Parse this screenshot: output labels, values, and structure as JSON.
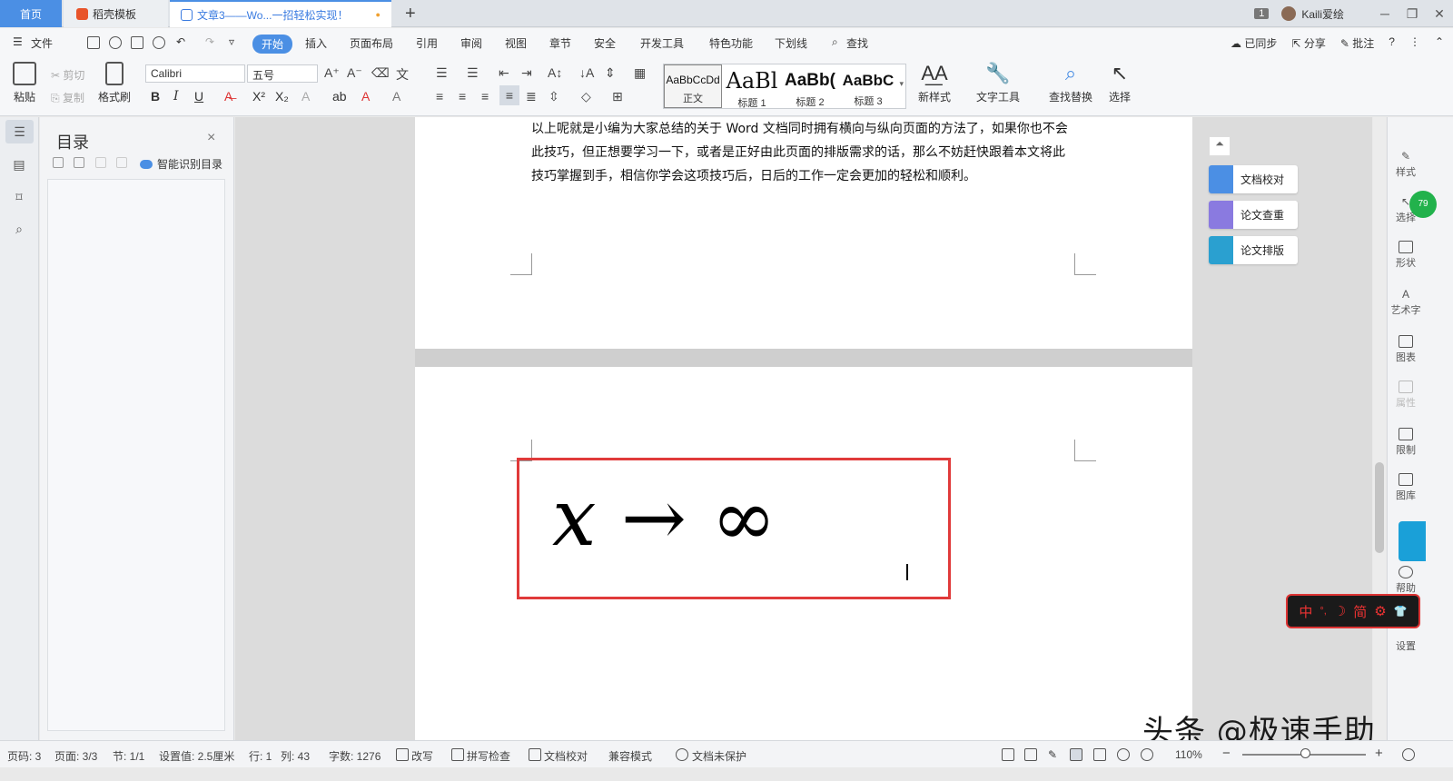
{
  "tabs": {
    "home": "首页",
    "template": "稻壳模板",
    "document": "文章3——Wo...一招轻松实现！",
    "unsaved_dot": "●",
    "new_tab": "+",
    "page_badge": "1",
    "user": "Kaili爱绘",
    "minimize": "─",
    "restore": "❐",
    "close": "✕"
  },
  "menu": {
    "file": "文件",
    "start": "开始",
    "insert": "插入",
    "layout": "页面布局",
    "reference": "引用",
    "review": "审阅",
    "view": "视图",
    "chapter": "章节",
    "security": "安全",
    "devtools": "开发工具",
    "special": "特色功能",
    "underline": "下划线",
    "find": "查找",
    "synced": "已同步",
    "share": "分享",
    "comment": "批注",
    "help": "?",
    "more": "⋮",
    "collapse": "⌃"
  },
  "ribbon": {
    "paste": "粘贴",
    "cut": "剪切",
    "copy": "复制",
    "format_painter": "格式刷",
    "font_name": "Calibri",
    "font_size": "五号",
    "bold": "B",
    "italic": "I",
    "underline": "U",
    "styles": [
      {
        "sample": "AaBbCcDd",
        "label": "正文"
      },
      {
        "sample": "AaBl",
        "label": "标题 1"
      },
      {
        "sample": "AaBb(",
        "label": "标题 2"
      },
      {
        "sample": "AaBbC",
        "label": "标题 3"
      }
    ],
    "new_style": "新样式",
    "text_tools": "文字工具",
    "find_replace": "查找替换",
    "select": "选择"
  },
  "toc": {
    "title": "目录",
    "close": "×",
    "smart": "智能识别目录"
  },
  "document": {
    "paragraph": "以上呢就是小编为大家总结的关于 Word 文档同时拥有横向与纵向页面的方法了，如果你也不会此技巧，但正想要学习一下，或者是正好由此页面的排版需求的话，那么不妨赶快跟着本文将此技巧掌握到手，相信你学会这项技巧后，日后的工作一定会更加的轻松和顺利。",
    "formula_var": "x",
    "formula_arrow": "→",
    "formula_inf": "∞"
  },
  "assistant": {
    "collapse": "⏶",
    "proofread": "文档校对",
    "plagiarism": "论文查重",
    "typeset": "论文排版"
  },
  "right_panel": {
    "style": "样式",
    "select": "选择",
    "shape": "形状",
    "art_text": "艺术字",
    "chart": "图表",
    "property": "属性",
    "restrict": "限制",
    "gallery": "图库",
    "help": "帮助",
    "settings": "设置",
    "badge": "79"
  },
  "ime": {
    "chinese": "中",
    "punct": "°,",
    "moon": "☽",
    "simplified": "简",
    "gear": "⚙",
    "shirt": "👕"
  },
  "watermark": "头条 @极速手助",
  "status": {
    "page_code": "页码: 3",
    "page": "页面: 3/3",
    "section": "节: 1/1",
    "setting": "设置值: 2.5厘米",
    "row": "行: 1",
    "col": "列: 43",
    "words": "字数: 1276",
    "revise": "改写",
    "spellcheck": "拼写检查",
    "proofread": "文档校对",
    "compat": "兼容模式",
    "unprotected": "文档未保护",
    "zoom": "110%",
    "zoom_minus": "−",
    "zoom_plus": "+"
  },
  "colors": {
    "accent": "#4b8fe4",
    "highlight_box": "#e03a3a"
  }
}
